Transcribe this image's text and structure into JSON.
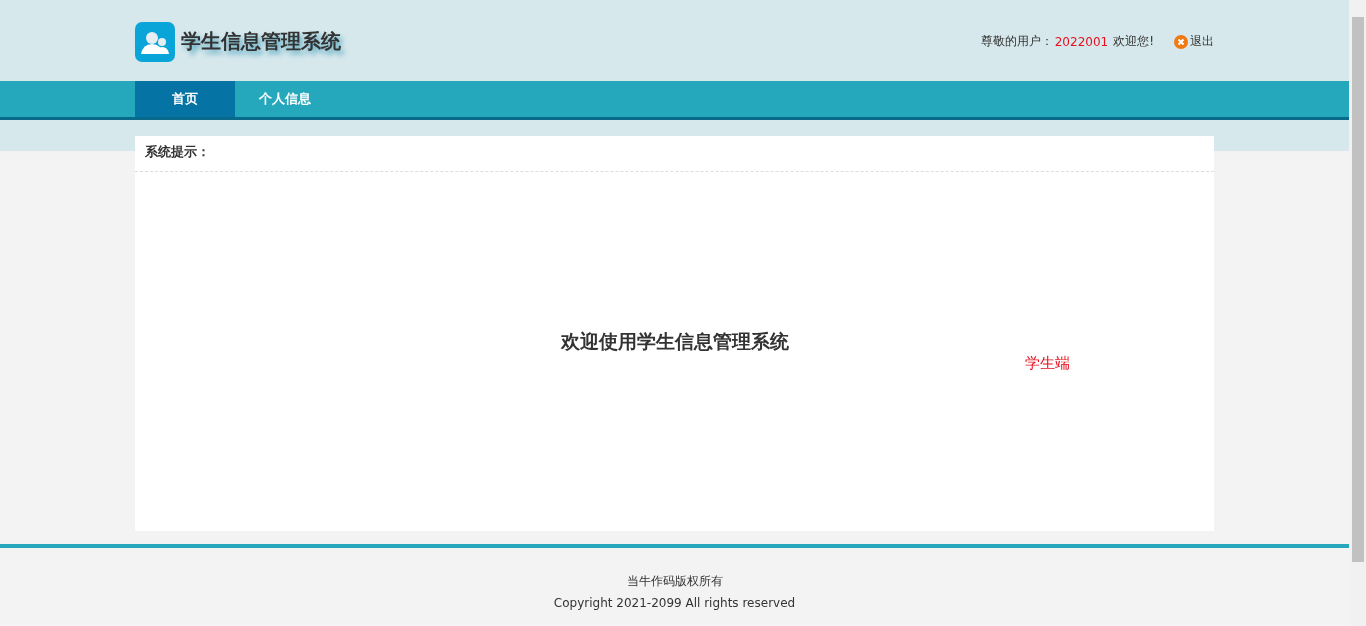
{
  "header": {
    "title": "学生信息管理系统",
    "greeting_prefix": "尊敬的用户：",
    "user_id": "2022001",
    "greeting_suffix": "欢迎您!",
    "logout": "退出"
  },
  "nav": [
    {
      "label": "首页",
      "selected": true
    },
    {
      "label": "个人信息",
      "selected": false
    }
  ],
  "panel": {
    "title": "系统提示：",
    "welcome": "欢迎使用学生信息管理系统",
    "role": "学生端"
  },
  "footer": {
    "owner": "当牛作码版权所有",
    "copyright": "Copyright 2021-2099 All rights reserved"
  }
}
